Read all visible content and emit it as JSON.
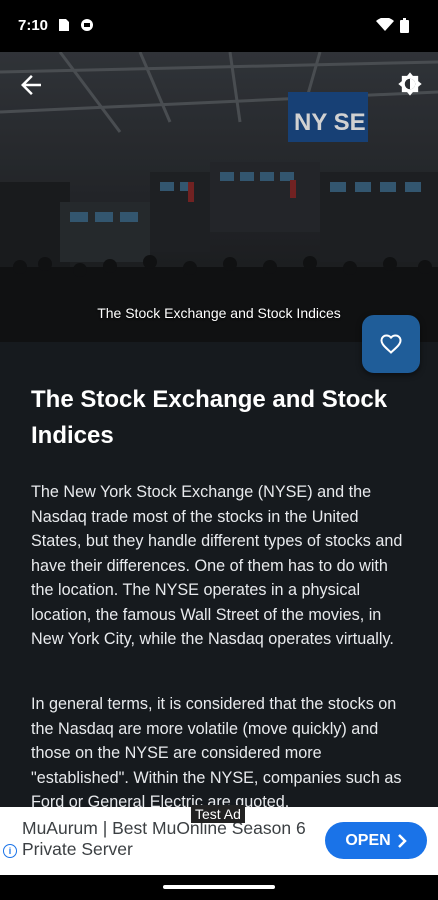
{
  "status": {
    "time": "7:10"
  },
  "hero": {
    "caption": "The Stock Exchange and Stock Indices",
    "sign_text": "NY SE"
  },
  "article": {
    "title": "The Stock Exchange and Stock Indices",
    "paragraph1": "The New York Stock Exchange (NYSE) and the Nasdaq trade most of the stocks in the United States, but they handle different types of stocks and have their differences. One of them has to do with the location. The NYSE operates in a physical location, the famous Wall Street of the movies, in New York City, while the Nasdaq operates virtually.",
    "paragraph2": "In general terms, it is considered that the stocks on the Nasdaq are more volatile (move quickly) and those on the NYSE are considered more \"established\". Within the NYSE, companies such as Ford or General Electric are quoted."
  },
  "ad": {
    "label": "Test Ad",
    "text": "MuAurum | Best MuOnline Season 6 Private Server",
    "open_label": "OPEN"
  },
  "colors": {
    "fav_button": "#1f5d99",
    "ad_button": "#1a73e8",
    "content_bg": "#161a1e"
  }
}
